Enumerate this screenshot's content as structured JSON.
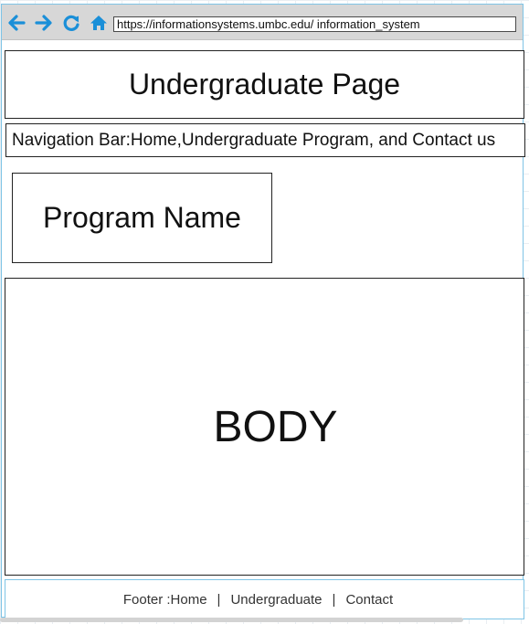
{
  "browser": {
    "url": "https://informationsystems.umbc.edu/ information_system",
    "icons": [
      "back-icon",
      "forward-icon",
      "refresh-icon",
      "home-icon"
    ]
  },
  "header": {
    "title": "Undergraduate Page"
  },
  "navigation": {
    "text": "Navigation Bar:Home,Undergraduate Program, and Contact us"
  },
  "program": {
    "name": "Program Name"
  },
  "body": {
    "label": "BODY"
  },
  "footer": {
    "prefix": "Footer :",
    "items": [
      "Home",
      "Undergraduate",
      "Contact"
    ],
    "separator": "|"
  },
  "colors": {
    "icon_blue": "#1a8fd8",
    "frame_border": "#7fc4e6",
    "toolbar_bg": "#d7d7d7"
  }
}
